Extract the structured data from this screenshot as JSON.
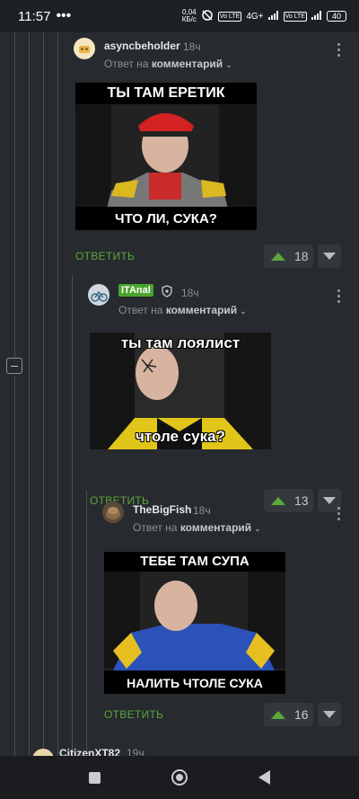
{
  "status_bar": {
    "time": "11:57",
    "dots": "•••",
    "speed_value": "0,04",
    "speed_unit": "КБ/с",
    "volte1": "Vo LTE",
    "net": "4G+",
    "volte2": "Vo LTE",
    "battery": "40"
  },
  "comments": [
    {
      "username": "asyncbeholder",
      "time": "18ч",
      "reply_prefix": "Ответ на",
      "reply_target": "комментарий",
      "meme_top": "ТЫ ТАМ ЕРЕТИК",
      "meme_bottom": "ЧТО ЛИ, СУКА?",
      "reply_label": "ОТВЕТИТЬ",
      "votes": "18"
    },
    {
      "username": "ITAnal",
      "time": "18ч",
      "reply_prefix": "Ответ на",
      "reply_target": "комментарий",
      "meme_top": "ты там лоялист",
      "meme_bottom": "чтоле сука?",
      "reply_label": "ОТВЕТИТЬ",
      "votes": "13"
    },
    {
      "username": "TheBigFish",
      "time": "18ч",
      "reply_prefix": "Ответ на",
      "reply_target": "комментарий",
      "meme_top": "ТЕБЕ ТАМ СУПА",
      "meme_bottom": "НАЛИТЬ ЧТОЛЕ СУКА",
      "reply_label": "ОТВЕТИТЬ",
      "votes": "16"
    },
    {
      "username": "CitizenXT82",
      "time": "19ч"
    }
  ],
  "colors": {
    "background": "#272a2e",
    "accent_green": "#5ba73c",
    "badge_green": "#4aa52e"
  }
}
